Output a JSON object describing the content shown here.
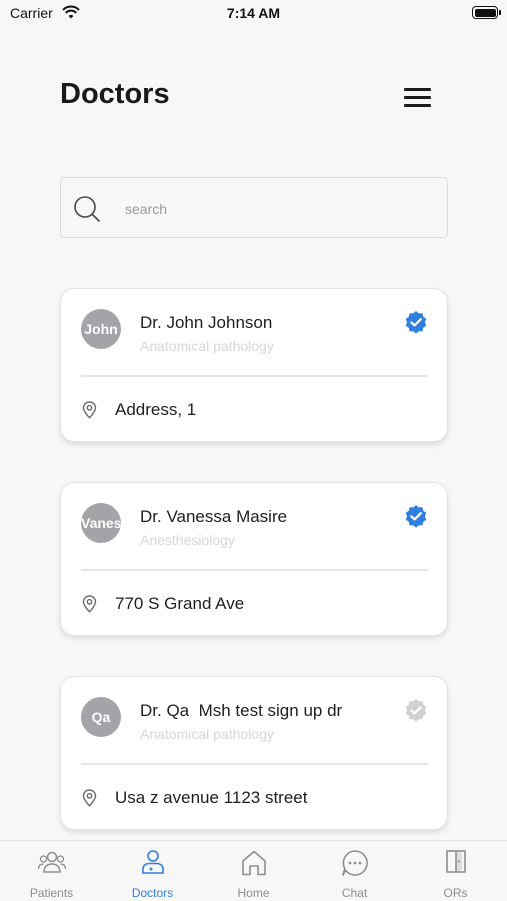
{
  "status_bar": {
    "carrier": "Carrier",
    "time": "7:14 AM"
  },
  "header": {
    "title": "Doctors"
  },
  "search": {
    "placeholder": "search",
    "value": ""
  },
  "doctors": [
    {
      "avatar_text": "John",
      "name": "Dr. John Johnson",
      "specialty": "Anatomical pathology",
      "address": "Address, 1",
      "verified": true
    },
    {
      "avatar_text": "Vanessa",
      "name": "Dr. Vanessa Masire",
      "specialty": "Anesthesiology",
      "address": "770 S Grand Ave",
      "verified": true
    },
    {
      "avatar_text": "Qa",
      "name": "Dr. Qa  Msh test sign up dr",
      "specialty": "Anatomical pathology",
      "address": "Usa z avenue 1123 street",
      "verified": false
    }
  ],
  "tabs": [
    {
      "label": "Patients",
      "icon": "patients-icon",
      "active": false
    },
    {
      "label": "Doctors",
      "icon": "doctor-icon",
      "active": true
    },
    {
      "label": "Home",
      "icon": "home-icon",
      "active": false
    },
    {
      "label": "Chat",
      "icon": "chat-icon",
      "active": false
    },
    {
      "label": "ORs",
      "icon": "door-icon",
      "active": false
    }
  ],
  "colors": {
    "accent": "#2f7fe0",
    "verified": "#2f7fe0",
    "unverified": "#d0d0d0",
    "avatar_bg": "#a3a3a8",
    "inactive_tab": "#8e8e8e"
  }
}
